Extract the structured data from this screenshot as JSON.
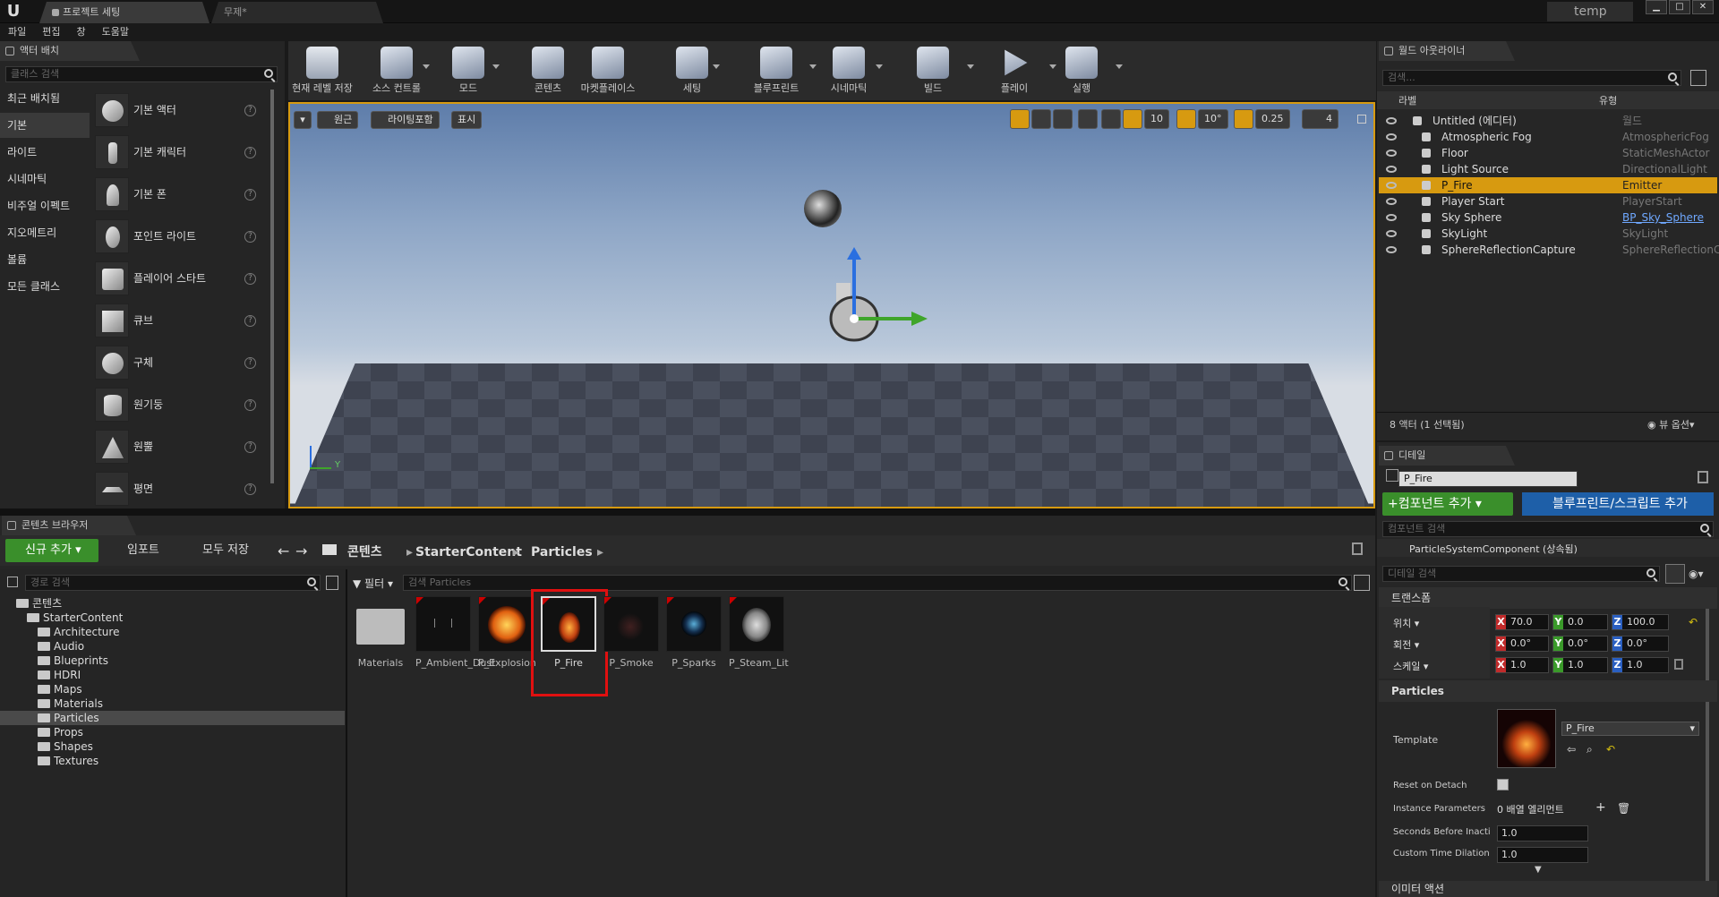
{
  "titlebar": {
    "tabs": [
      "프로젝트 세팅",
      "무제*"
    ],
    "user_box": "temp"
  },
  "menu": [
    "파일",
    "편집",
    "창",
    "도움말"
  ],
  "place_actors": {
    "tab": "액터 배치",
    "search_placeholder": "클래스 검색",
    "categories": [
      "최근 배치됨",
      "기본",
      "라이트",
      "시네마틱",
      "비주얼 이펙트",
      "지오메트리",
      "볼륨",
      "모든 클래스"
    ],
    "items": [
      "기본 액터",
      "기본 캐릭터",
      "기본 폰",
      "포인트 라이트",
      "플레이어 스타트",
      "큐브",
      "구체",
      "원기둥",
      "원뿔",
      "평면"
    ]
  },
  "toolbar": {
    "buttons": [
      "현재 레벨 저장",
      "소스 컨트롤",
      "모드",
      "콘텐츠",
      "마켓플레이스",
      "세팅",
      "블루프린트",
      "시네마틱",
      "빌드",
      "플레이",
      "실행"
    ]
  },
  "viewport": {
    "left_buttons": [
      "원근",
      "라이팅포함",
      "표시"
    ],
    "grid_snap": "10",
    "rotation_snap": "10°",
    "scale_snap": "0.25",
    "camera_speed": "4",
    "axis_y": "Y"
  },
  "content_browser": {
    "tab": "콘텐츠 브라우저",
    "add_new": "신규 추가",
    "import": "임포트",
    "save_all": "모두 저장",
    "breadcrumb": [
      "콘텐츠",
      "StarterContent",
      "Particles"
    ],
    "path_search_placeholder": "경로 검색",
    "filter_label": "필터",
    "asset_search_placeholder": "검색 Particles",
    "tree": [
      {
        "label": "콘텐츠",
        "level": 0
      },
      {
        "label": "StarterContent",
        "level": 1
      },
      {
        "label": "Architecture",
        "level": 2
      },
      {
        "label": "Audio",
        "level": 2
      },
      {
        "label": "Blueprints",
        "level": 2
      },
      {
        "label": "HDRI",
        "level": 2
      },
      {
        "label": "Maps",
        "level": 2
      },
      {
        "label": "Materials",
        "level": 2
      },
      {
        "label": "Particles",
        "level": 2
      },
      {
        "label": "Props",
        "level": 2
      },
      {
        "label": "Shapes",
        "level": 2
      },
      {
        "label": "Textures",
        "level": 2
      }
    ],
    "assets": [
      "Materials",
      "P_Ambient_Dust",
      "P_Explosion",
      "P_Fire",
      "P_Smoke",
      "P_Sparks",
      "P_Steam_Lit"
    ],
    "selected_asset": "P_Fire",
    "highlight_color": "#e01010"
  },
  "outliner": {
    "tab": "월드 아웃라이너",
    "search_placeholder": "검색...",
    "col_label": "라벨",
    "col_type": "유형",
    "rows": [
      {
        "label": "Untitled (에디터)",
        "type": "월드"
      },
      {
        "label": "Atmospheric Fog",
        "type": "AtmosphericFog"
      },
      {
        "label": "Floor",
        "type": "StaticMeshActor"
      },
      {
        "label": "Light Source",
        "type": "DirectionalLight"
      },
      {
        "label": "P_Fire",
        "type": "Emitter"
      },
      {
        "label": "Player Start",
        "type": "PlayerStart"
      },
      {
        "label": "Sky Sphere",
        "type": "BP_Sky_Sphere"
      },
      {
        "label": "SkyLight",
        "type": "SkyLight"
      },
      {
        "label": "SphereReflectionCapture",
        "type": "SphereReflectionC"
      }
    ],
    "status": "8 액터 (1 선택됨)",
    "view_options": "뷰 옵션"
  },
  "details": {
    "tab": "디테일",
    "name": "P_Fire",
    "add_component": "+컴포넌트 추가",
    "add_blueprint": "블루프린트/스크립트 추가",
    "component_search": "컴포넌트 검색",
    "component": "ParticleSystemComponent (상속됨)",
    "detail_search": "디테일 검색",
    "transform_header": "트랜스폼",
    "location_label": "위치",
    "rotation_label": "회전",
    "scale_label": "스케일",
    "location": [
      "70.0",
      "0.0",
      "100.0"
    ],
    "rotation": [
      "0.0°",
      "0.0°",
      "0.0°"
    ],
    "scale": [
      "1.0",
      "1.0",
      "1.0"
    ],
    "particles_header": "Particles",
    "template_label": "Template",
    "template_value": "P_Fire",
    "reset_label": "Reset on Detach",
    "instance_label": "Instance Parameters",
    "instance_value": "0 배열 엘리먼트",
    "seconds_label": "Seconds Before Inacti",
    "seconds_value": "1.0",
    "dilation_label": "Custom Time Dilation",
    "dilation_value": "1.0",
    "emitter_actions": "이미터 액션"
  }
}
